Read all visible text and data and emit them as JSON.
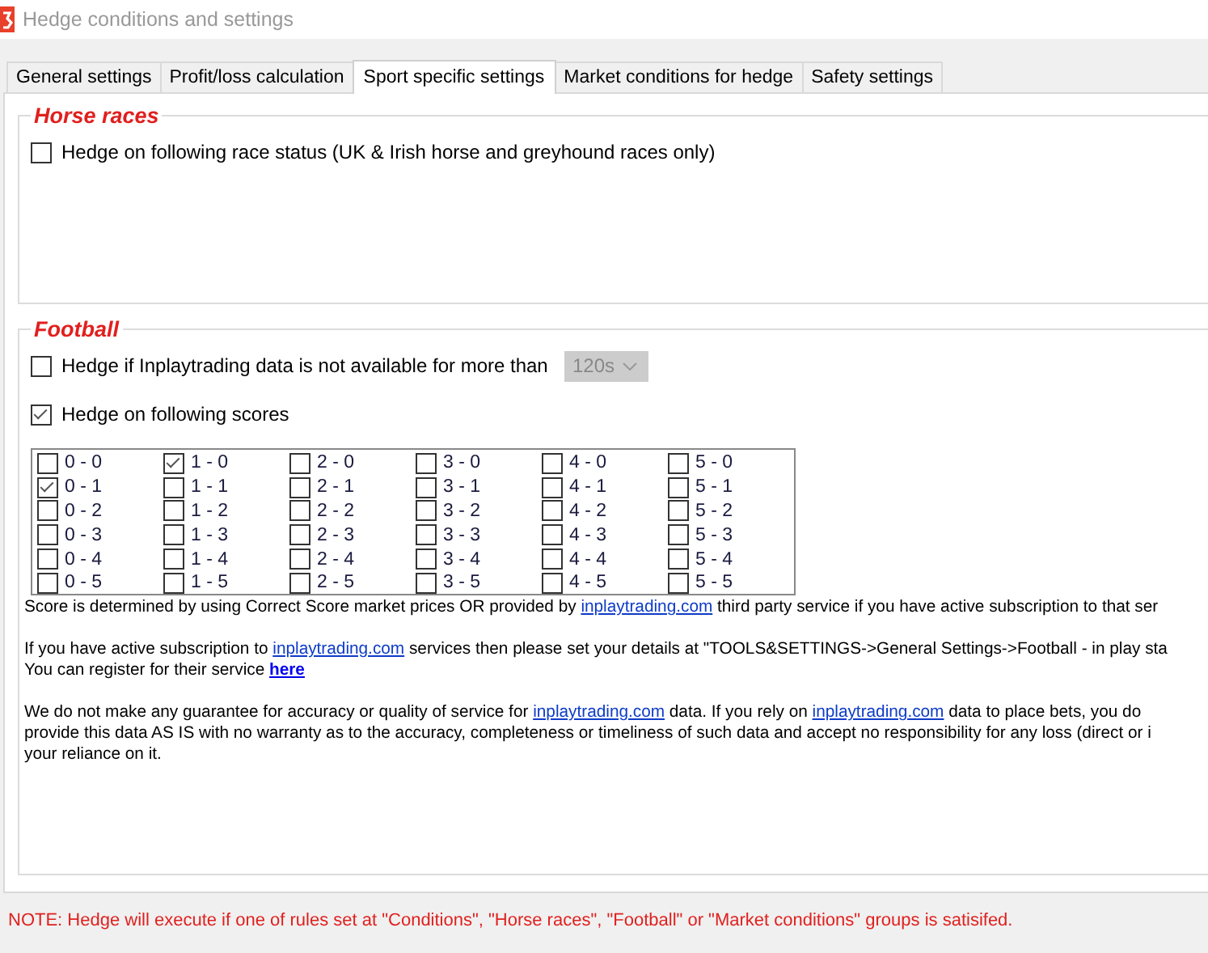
{
  "window": {
    "title": "Hedge conditions and settings"
  },
  "tabs": [
    {
      "label": "General settings",
      "selected": false
    },
    {
      "label": "Profit/loss calculation",
      "selected": false
    },
    {
      "label": "Sport specific settings",
      "selected": true
    },
    {
      "label": "Market conditions for hedge",
      "selected": false
    },
    {
      "label": "Safety settings",
      "selected": false
    }
  ],
  "horse_races": {
    "title": "Horse races",
    "options": [
      {
        "label": "Hedge on following race status (UK & Irish horse and greyhound races only)",
        "checked": false
      }
    ]
  },
  "football": {
    "title": "Football",
    "data_timeout": {
      "label": "Hedge if Inplaytrading data is not available for more than",
      "checked": false,
      "dropdown": {
        "value": "120s",
        "disabled": true
      }
    },
    "scores_option": {
      "label": "Hedge on following scores",
      "checked": true
    },
    "scores": [
      {
        "cells": [
          {
            "label": "0 - 0",
            "checked": false
          },
          {
            "label": "1 - 0",
            "checked": true
          },
          {
            "label": "2 - 0",
            "checked": false
          },
          {
            "label": "3 - 0",
            "checked": false
          },
          {
            "label": "4 - 0",
            "checked": false
          },
          {
            "label": "5 - 0",
            "checked": false
          }
        ]
      },
      {
        "cells": [
          {
            "label": "0 - 1",
            "checked": true
          },
          {
            "label": "1 - 1",
            "checked": false
          },
          {
            "label": "2 - 1",
            "checked": false
          },
          {
            "label": "3 - 1",
            "checked": false
          },
          {
            "label": "4 - 1",
            "checked": false
          },
          {
            "label": "5 - 1",
            "checked": false
          }
        ]
      },
      {
        "cells": [
          {
            "label": "0 - 2",
            "checked": false
          },
          {
            "label": "1 - 2",
            "checked": false
          },
          {
            "label": "2 - 2",
            "checked": false
          },
          {
            "label": "3 - 2",
            "checked": false
          },
          {
            "label": "4 - 2",
            "checked": false
          },
          {
            "label": "5 - 2",
            "checked": false
          }
        ]
      },
      {
        "cells": [
          {
            "label": "0 - 3",
            "checked": false
          },
          {
            "label": "1 - 3",
            "checked": false
          },
          {
            "label": "2 - 3",
            "checked": false
          },
          {
            "label": "3 - 3",
            "checked": false
          },
          {
            "label": "4 - 3",
            "checked": false
          },
          {
            "label": "5 - 3",
            "checked": false
          }
        ]
      },
      {
        "cells": [
          {
            "label": "0 - 4",
            "checked": false
          },
          {
            "label": "1 - 4",
            "checked": false
          },
          {
            "label": "2 - 4",
            "checked": false
          },
          {
            "label": "3 - 4",
            "checked": false
          },
          {
            "label": "4 - 4",
            "checked": false
          },
          {
            "label": "5 - 4",
            "checked": false
          }
        ]
      },
      {
        "cells": [
          {
            "label": "0 - 5",
            "checked": false
          },
          {
            "label": "1 - 5",
            "checked": false
          },
          {
            "label": "2 - 5",
            "checked": false
          },
          {
            "label": "3 - 5",
            "checked": false
          },
          {
            "label": "4 - 5",
            "checked": false
          },
          {
            "label": "5 - 5",
            "checked": false
          }
        ]
      }
    ],
    "paragraphs": [
      {
        "lines": [
          [
            {
              "kind": "text",
              "text": "Score is determined by using Correct Score market prices OR provided by "
            },
            {
              "kind": "link",
              "text": "inplaytrading.com"
            },
            {
              "kind": "text",
              "text": " third party service if you have active subscription to that ser"
            }
          ]
        ]
      },
      {
        "lines": [
          [
            {
              "kind": "text",
              "text": "If you have active subscription to "
            },
            {
              "kind": "link",
              "text": "inplaytrading.com"
            },
            {
              "kind": "text",
              "text": " services then please set your details at \"TOOLS&SETTINGS->General Settings->Football - in play sta"
            }
          ],
          [
            {
              "kind": "text",
              "text": "You can register for their service "
            },
            {
              "kind": "bold_link",
              "text": "here"
            }
          ]
        ]
      },
      {
        "lines": [
          [
            {
              "kind": "text",
              "text": "We do not make any guarantee for accuracy or quality of service for "
            },
            {
              "kind": "link",
              "text": "inplaytrading.com"
            },
            {
              "kind": "text",
              "text": " data. If you rely on "
            },
            {
              "kind": "link",
              "text": "inplaytrading.com"
            },
            {
              "kind": "text",
              "text": " data to place bets, you do"
            }
          ],
          [
            {
              "kind": "text",
              "text": "provide this data AS IS with no warranty as to the accuracy, completeness or timeliness of such data and accept no responsibility for any loss (direct or i"
            }
          ],
          [
            {
              "kind": "text",
              "text": "your reliance on it."
            }
          ]
        ]
      }
    ]
  },
  "note": "NOTE: Hedge will execute if one of rules set at \"Conditions\", \"Horse races\", \"Football\" or \"Market conditions\" groups is satisifed."
}
